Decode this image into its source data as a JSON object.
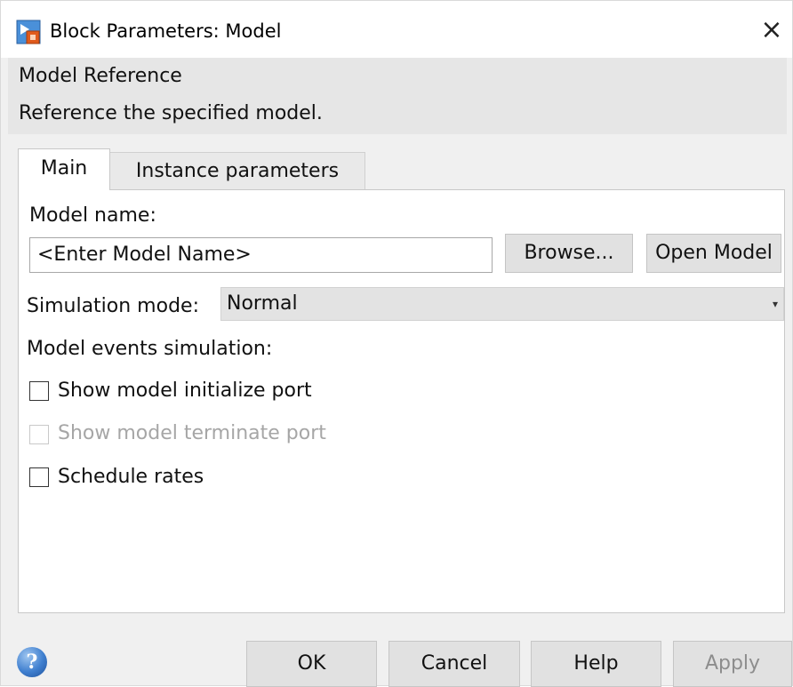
{
  "window": {
    "title": "Block Parameters: Model",
    "close_glyph": "×"
  },
  "header": {
    "block_type": "Model Reference",
    "description": "Reference the specified model."
  },
  "tabs": [
    {
      "label": "Main",
      "active": true
    },
    {
      "label": "Instance parameters",
      "active": false
    }
  ],
  "main": {
    "model_name_label": "Model name:",
    "model_name_value": "<Enter Model Name>",
    "browse_label": "Browse...",
    "open_model_label": "Open Model",
    "simulation_mode_label": "Simulation mode:",
    "simulation_mode_value": "Normal",
    "model_events_label": "Model events simulation:",
    "options": [
      {
        "label": "Show model initialize port",
        "checked": false,
        "enabled": true
      },
      {
        "label": "Show model terminate port",
        "checked": false,
        "enabled": false
      },
      {
        "label": "Schedule rates",
        "checked": false,
        "enabled": true
      }
    ]
  },
  "footer": {
    "help_icon_glyph": "?",
    "ok_label": "OK",
    "cancel_label": "Cancel",
    "help_label": "Help",
    "apply_label": "Apply"
  },
  "icons": {
    "app": "simulink-block-icon",
    "close": "close-icon",
    "help": "help-icon",
    "dropdown": "chevron-down-icon"
  },
  "colors": {
    "dialog_bg": "#f0f0f0",
    "panel_bg": "#ffffff",
    "disabled_text": "#a6a6a6"
  }
}
